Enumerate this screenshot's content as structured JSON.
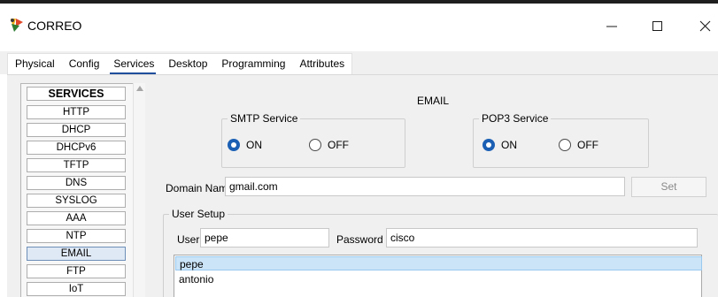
{
  "window": {
    "title": "CORREO",
    "icon": "packet-tracer-server-icon",
    "controls": [
      "minimize-icon",
      "maximize-icon",
      "close-icon"
    ]
  },
  "tabs": [
    {
      "label": "Physical",
      "active": false
    },
    {
      "label": "Config",
      "active": false
    },
    {
      "label": "Services",
      "active": true
    },
    {
      "label": "Desktop",
      "active": false
    },
    {
      "label": "Programming",
      "active": false
    },
    {
      "label": "Attributes",
      "active": false
    }
  ],
  "services": {
    "header": "SERVICES",
    "items": [
      "HTTP",
      "DHCP",
      "DHCPv6",
      "TFTP",
      "DNS",
      "SYSLOG",
      "AAA",
      "NTP",
      "EMAIL",
      "FTP",
      "IoT"
    ],
    "selected": "EMAIL"
  },
  "email": {
    "heading": "EMAIL",
    "smtp": {
      "legend": "SMTP Service",
      "on_label": "ON",
      "off_label": "OFF",
      "value": "ON"
    },
    "pop3": {
      "legend": "POP3 Service",
      "on_label": "ON",
      "off_label": "OFF",
      "value": "ON"
    },
    "domain_label": "Domain Name:",
    "domain_value": "gmail.com",
    "set_label": "Set",
    "user_setup": {
      "legend": "User Setup",
      "user_label": "User",
      "user_value": "pepe",
      "password_label": "Password",
      "password_value": "cisco",
      "users": [
        "pepe",
        "antonio"
      ],
      "selected_user": "pepe"
    }
  },
  "colors": {
    "accent": "#1a5fb4",
    "tab_underline": "#1f4e9c",
    "selected_row": "#cce4f7",
    "panel_bg": "#f0f0f0"
  }
}
